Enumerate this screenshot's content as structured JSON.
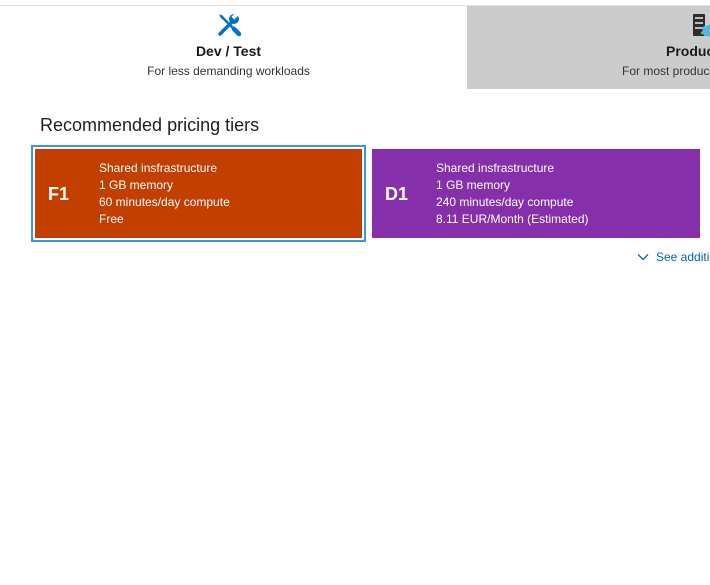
{
  "workloads": {
    "dev_test": {
      "title": "Dev / Test",
      "subtitle": "For less demanding workloads",
      "icon": "tools-icon"
    },
    "production": {
      "title": "Produc",
      "subtitle": "For most produc",
      "icon": "server-icon"
    }
  },
  "section": {
    "title": "Recommended pricing tiers"
  },
  "tiers": [
    {
      "code": "F1",
      "infrastructure": "Shared insfrastructure",
      "memory": "1 GB memory",
      "compute": "60 minutes/day compute",
      "price": "Free",
      "color": "#c23f00",
      "selected": true
    },
    {
      "code": "D1",
      "infrastructure": "Shared insfrastructure",
      "memory": "1 GB memory",
      "compute": "240 minutes/day compute",
      "price": "8.11 EUR/Month (Estimated)",
      "color": "#862fab",
      "selected": false
    }
  ],
  "see_more": {
    "label": "See additi",
    "icon": "chevron-down-icon"
  },
  "colors": {
    "selection_outline": "#3a96dd",
    "link": "#0062b8",
    "inactive_tab": "#cccccc"
  }
}
